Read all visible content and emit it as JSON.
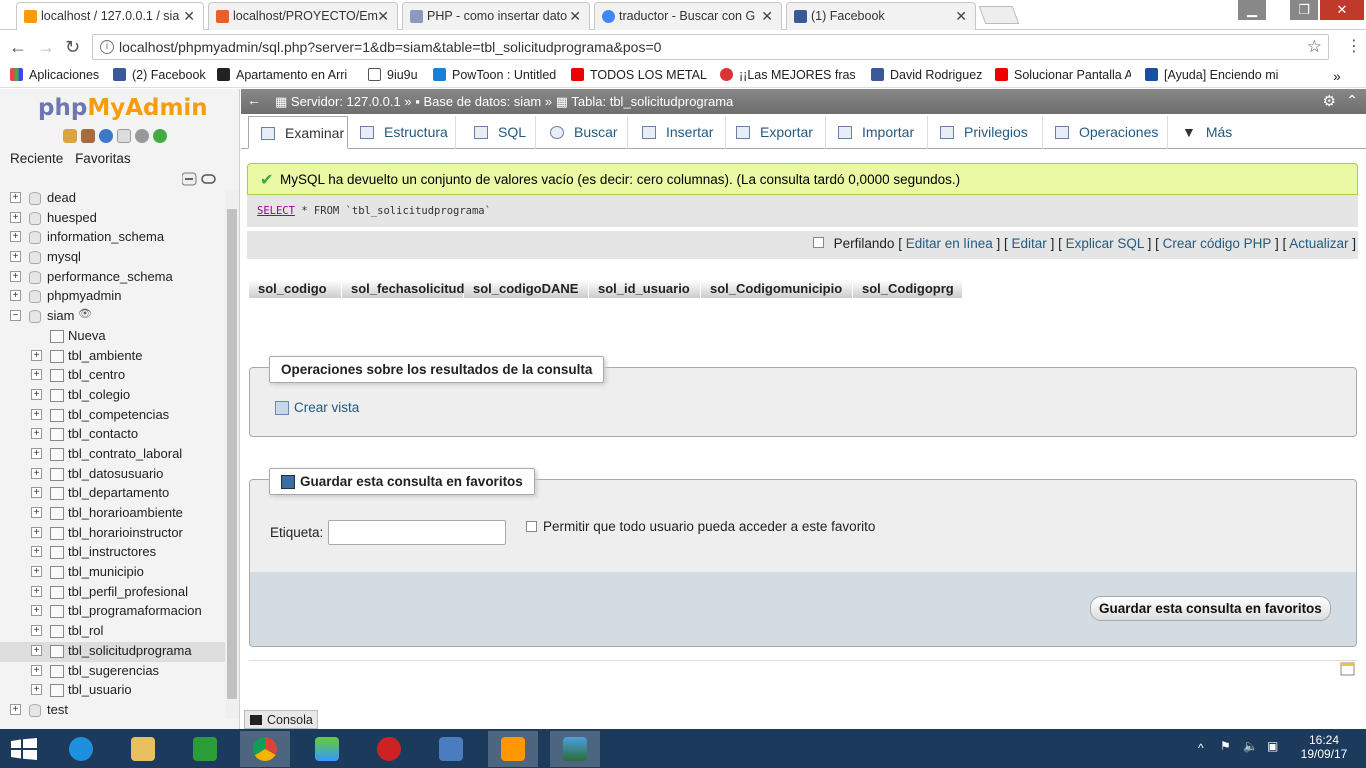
{
  "browser": {
    "tabs": [
      {
        "title": "localhost / 127.0.0.1 / sia",
        "icon": "pma-icon",
        "color": "#f89c0e"
      },
      {
        "title": "localhost/PROYECTO/Em",
        "icon": "xampp-icon",
        "color": "#e8612c"
      },
      {
        "title": "PHP - como insertar dato",
        "icon": "page-icon",
        "color": "#8a9bbf"
      },
      {
        "title": "traductor - Buscar con G",
        "icon": "google-icon",
        "color": "#4285f4"
      },
      {
        "title": "(1) Facebook",
        "icon": "facebook-icon",
        "color": "#3b5998"
      }
    ],
    "url": "localhost/phpmyadmin/sql.php?server=1&db=siam&table=tbl_solicitudprograma&pos=0",
    "bookmarks": [
      {
        "label": "Aplicaciones",
        "color": "#e44"
      },
      {
        "label": "(2) Facebook",
        "color": "#3b5998"
      },
      {
        "label": "Apartamento en Arri",
        "color": "#222"
      },
      {
        "label": "9iu9u",
        "color": "#fff"
      },
      {
        "label": "PowToon : Untitled",
        "color": "#1c7fd6"
      },
      {
        "label": "TODOS LOS METAL S",
        "color": "#e00"
      },
      {
        "label": "¡¡Las MEJORES frases",
        "color": "#d33"
      },
      {
        "label": "David Rodriguez",
        "color": "#3b5998"
      },
      {
        "label": "Solucionar Pantalla A",
        "color": "#e00"
      },
      {
        "label": "[Ayuda] Enciendo mi",
        "color": "#1a4fa0"
      }
    ]
  },
  "nav": {
    "logo_php": "php",
    "logo_myadmin": "MyAdmin",
    "tab_recent": "Reciente",
    "tab_favorites": "Favoritas",
    "databases_before": [
      "dead",
      "huesped",
      "information_schema",
      "mysql",
      "performance_schema",
      "phpmyadmin"
    ],
    "current_db": "siam",
    "new_label": "Nueva",
    "tables": [
      "tbl_ambiente",
      "tbl_centro",
      "tbl_colegio",
      "tbl_competencias",
      "tbl_contacto",
      "tbl_contrato_laboral",
      "tbl_datosusuario",
      "tbl_departamento",
      "tbl_horarioambiente",
      "tbl_horarioinstructor",
      "tbl_instructores",
      "tbl_municipio",
      "tbl_perfil_profesional",
      "tbl_programaformacion",
      "tbl_rol",
      "tbl_solicitudprograma",
      "tbl_sugerencias",
      "tbl_usuario"
    ],
    "selected_table": "tbl_solicitudprograma",
    "databases_after": [
      "test"
    ]
  },
  "breadcrumb": {
    "server": "Servidor: 127.0.0.1 »",
    "database": "Base de datos: siam »",
    "table": "Tabla: tbl_solicitudprograma"
  },
  "menu": [
    "Examinar",
    "Estructura",
    "SQL",
    "Buscar",
    "Insertar",
    "Exportar",
    "Importar",
    "Privilegios",
    "Operaciones",
    "Más"
  ],
  "result": {
    "message": "MySQL ha devuelto un conjunto de valores vacío (es decir: cero columnas). (La consulta tardó 0,0000 segundos.)",
    "sql_select": "SELECT",
    "sql_star": "*",
    "sql_from": "FROM",
    "sql_table": "`tbl_solicitudprograma`",
    "profiling": "Perfilando",
    "links": [
      "Editar en línea",
      "Editar",
      "Explicar SQL",
      "Crear código PHP",
      "Actualizar"
    ],
    "columns": [
      "sol_codigo",
      "sol_fechasolicitud",
      "sol_codigoDANE",
      "sol_id_usuario",
      "sol_Codigomunicipio",
      "sol_Codigoprg"
    ]
  },
  "operations": {
    "legend": "Operaciones sobre los resultados de la consulta",
    "create_view": "Crear vista"
  },
  "bookmark_form": {
    "legend": "Guardar esta consulta en favoritos",
    "label": "Etiqueta:",
    "input_value": "",
    "shared_label": "Permitir que todo usuario pueda acceder a este favorito",
    "submit": "Guardar esta consulta en favoritos"
  },
  "console_label": "Consola",
  "taskbar": {
    "time": "16:24",
    "date": "19/09/17"
  }
}
